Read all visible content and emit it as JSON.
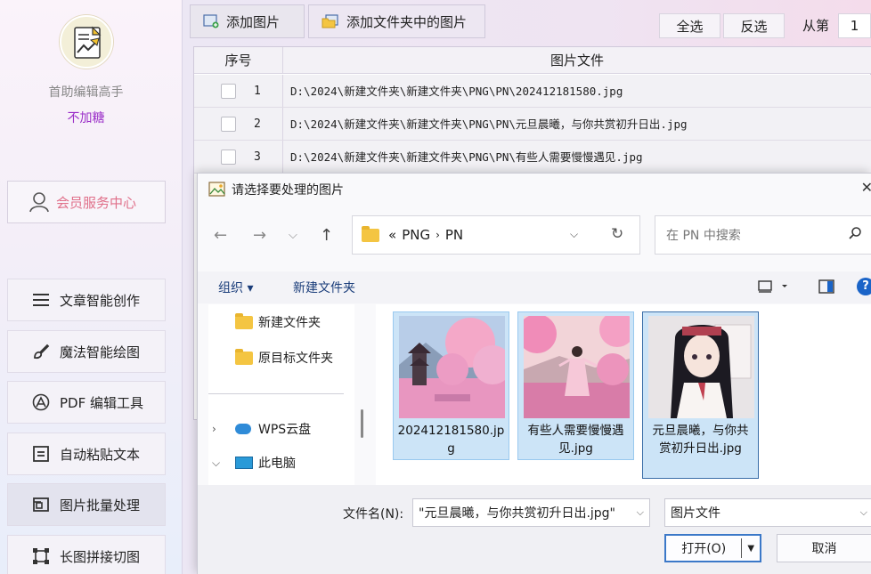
{
  "sidebar": {
    "app_name": "首助编辑高手",
    "app_sub": "不加糖",
    "member_label": "会员服务中心",
    "items": [
      {
        "label": "文章智能创作",
        "icon": "list-icon"
      },
      {
        "label": "魔法智能绘图",
        "icon": "brush-icon"
      },
      {
        "label": "PDF 编辑工具",
        "icon": "pdf-icon"
      },
      {
        "label": "自动粘贴文本",
        "icon": "paste-icon"
      },
      {
        "label": "图片批量处理",
        "icon": "image-batch-icon"
      },
      {
        "label": "长图拼接切图",
        "icon": "crop-icon"
      }
    ]
  },
  "toolbar": {
    "add_images": "添加图片",
    "add_folder_images": "添加文件夹中的图片",
    "select_all": "全选",
    "invert": "反选",
    "from_label": "从第",
    "from_value": "1"
  },
  "table": {
    "col_no": "序号",
    "col_file": "图片文件",
    "rows": [
      {
        "no": "1",
        "path": "D:\\2024\\新建文件夹\\新建文件夹\\PNG\\PN\\202412181580.jpg"
      },
      {
        "no": "2",
        "path": "D:\\2024\\新建文件夹\\新建文件夹\\PNG\\PN\\元旦晨曦，与你共赏初升日出.jpg"
      },
      {
        "no": "3",
        "path": "D:\\2024\\新建文件夹\\新建文件夹\\PNG\\PN\\有些人需要慢慢遇见.jpg"
      }
    ]
  },
  "dialog": {
    "title": "请选择要处理的图片",
    "breadcrumb_prefix": "«",
    "breadcrumb": [
      "PNG",
      "PN"
    ],
    "search_placeholder": "在 PN 中搜索",
    "organize": "组织 ▾",
    "new_folder": "新建文件夹",
    "tree": [
      {
        "label": "新建文件夹"
      },
      {
        "label": "原目标文件夹"
      },
      {
        "label": "WPS云盘"
      },
      {
        "label": "此电脑"
      }
    ],
    "files": [
      {
        "name": "202412181580.jpg",
        "selected": true
      },
      {
        "name": "有些人需要慢慢遇见.jpg",
        "selected": true
      },
      {
        "name": "元旦晨曦，与你共赏初升日出.jpg",
        "selected": true
      }
    ],
    "filename_label": "文件名(N):",
    "filename_value": "\"元旦晨曦，与你共赏初升日出.jpg\"",
    "file_type": "图片文件",
    "open_label": "打开(O)",
    "cancel_label": "取消"
  }
}
